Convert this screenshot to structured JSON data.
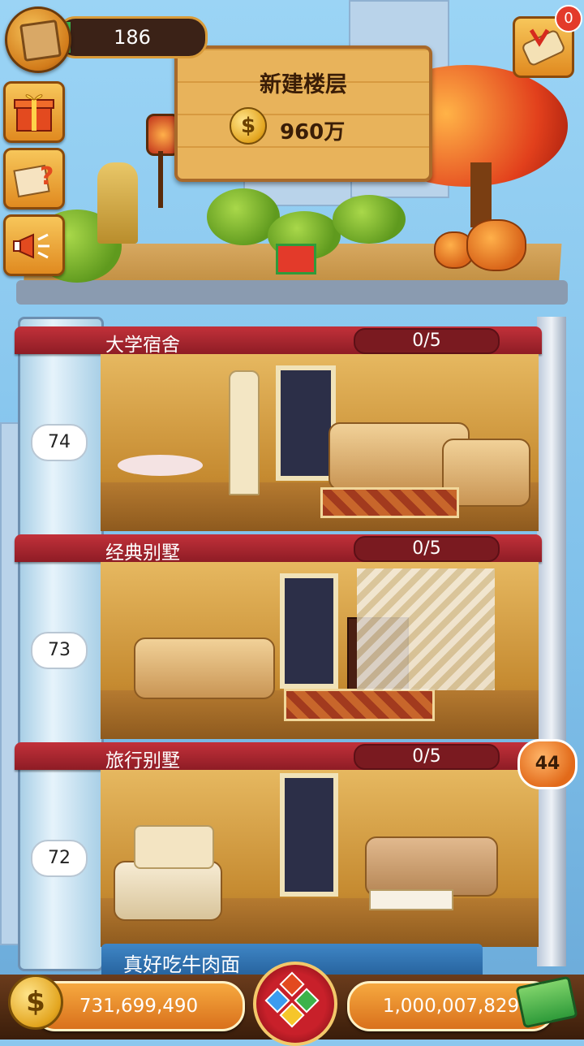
{
  "hud": {
    "top_count": "186",
    "notification_badge": "0",
    "left_buttons": [
      "gift-icon",
      "quest-note-icon",
      "megaphone-icon"
    ],
    "top_right_button": "scroll-icon"
  },
  "sign": {
    "title": "新建楼层",
    "price": "960万",
    "coin_symbol": "$"
  },
  "floors": [
    {
      "name": "大学宿舍",
      "progress": "0/5",
      "level": "74"
    },
    {
      "name": "经典别墅",
      "progress": "0/5",
      "level": "73"
    },
    {
      "name": "旅行别墅",
      "progress": "0/5",
      "level": "72"
    }
  ],
  "chat_bubble": "44",
  "bottom": {
    "floor_name": "真好吃牛肉面",
    "coins": "731,699,490",
    "cash": "1,000,007,829",
    "coin_symbol": "$"
  },
  "colors": {
    "floor_bar": "#b3222c",
    "wood": "#e8b35b",
    "coin": "#e3a51f",
    "sky": "#8cc7ee"
  }
}
